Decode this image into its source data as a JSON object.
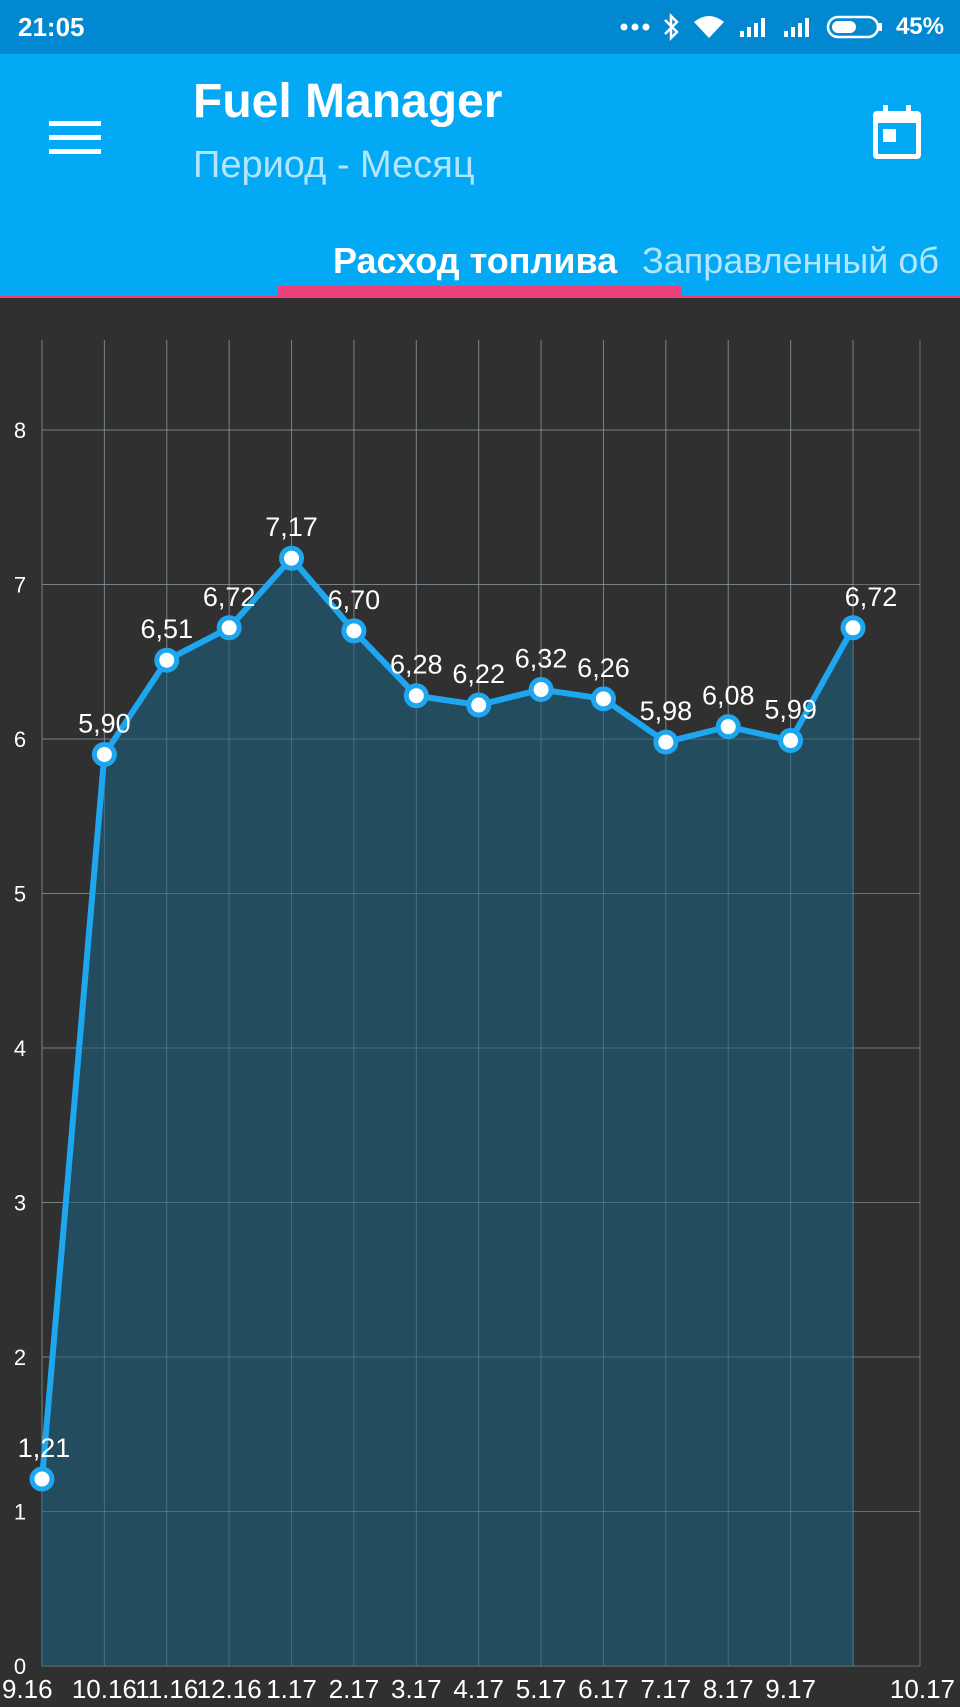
{
  "status_bar": {
    "time": "21:05",
    "battery_percent": "45%",
    "icons": [
      "more-dots-icon",
      "bluetooth-icon",
      "wifi-icon",
      "signal-icon",
      "signal-icon",
      "battery-icon"
    ]
  },
  "app_bar": {
    "title": "Fuel Manager",
    "subtitle": "Период - Месяц",
    "menu_icon": "hamburger-menu-icon",
    "calendar_icon": "calendar-icon"
  },
  "tabs": [
    {
      "label": "Расход топлива",
      "active": true
    },
    {
      "label": "Заправленный об",
      "active": false
    }
  ],
  "colors": {
    "status_bar": "#0288d1",
    "app_bar": "#03a9f4",
    "tab_indicator": "#ec407a",
    "chart_background": "#303030",
    "line": "#1ea7ef",
    "fill": "#244e62"
  },
  "chart_data": {
    "type": "area",
    "x": [
      "9.16",
      "10.16",
      "11.16",
      "12.16",
      "1.17",
      "2.17",
      "3.17",
      "4.17",
      "5.17",
      "6.17",
      "7.17",
      "8.17",
      "9.17",
      "10.17"
    ],
    "values": [
      1.21,
      5.9,
      6.51,
      6.72,
      7.17,
      6.7,
      6.28,
      6.22,
      6.32,
      6.26,
      5.98,
      6.08,
      5.99,
      6.72
    ],
    "value_labels": [
      "1,21",
      "5,90",
      "6,51",
      "6,72",
      "7,17",
      "6,70",
      "6,28",
      "6,22",
      "6,32",
      "6,26",
      "5,98",
      "6,08",
      "5,99",
      "6,72"
    ],
    "y_ticks": [
      "0",
      "1",
      "2",
      "3",
      "4",
      "5",
      "6",
      "7",
      "8"
    ],
    "ylim": [
      0,
      8.6
    ],
    "grid": true,
    "title": "",
    "xlabel": "",
    "ylabel": ""
  }
}
